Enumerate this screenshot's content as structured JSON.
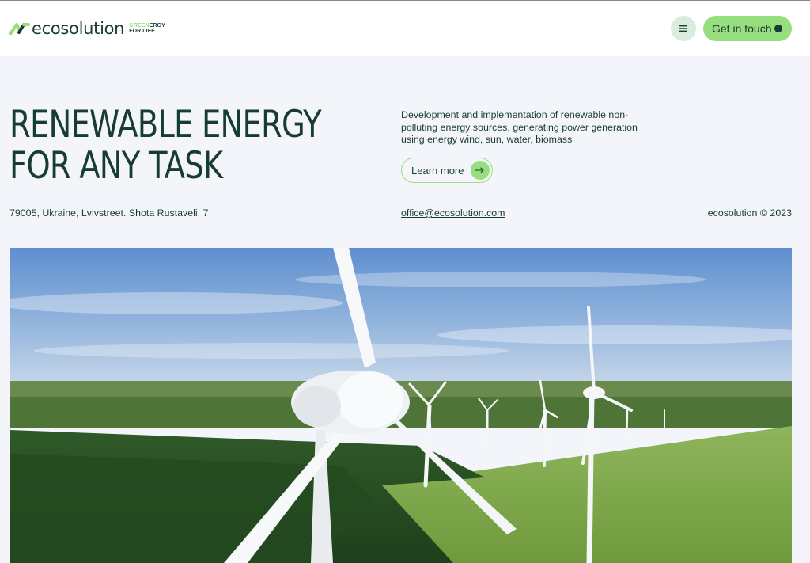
{
  "header": {
    "logo": {
      "name": "ecosolution",
      "tagline_green": "GREEN",
      "tagline_dark": "ERGY",
      "tagline_line2": "FOR LIFE"
    },
    "menu_icon": "menu-icon",
    "cta_label": "Get in touch"
  },
  "hero": {
    "title_line1": "RENEWABLE ENERGY",
    "title_line2": "FOR ANY TASK",
    "description": "Development and implementation of renewable non-polluting energy sources, generating power generation using energy wind, sun, water, biomass",
    "learn_more_label": "Learn more",
    "arrow_icon": "arrow-right-icon"
  },
  "info_bar": {
    "address": "79005, Ukraine, Lvivstreet. Shota Rustaveli, 7",
    "email": "office@ecosolution.com",
    "copyright": "ecosolution © 2023"
  },
  "colors": {
    "accent": "#97de7e",
    "dark": "#173d33",
    "background": "#f3f5fa",
    "header_bg": "#ffffff",
    "menu_bg": "#dcecdc"
  },
  "image": {
    "subject": "wind-turbines-field-photo"
  }
}
